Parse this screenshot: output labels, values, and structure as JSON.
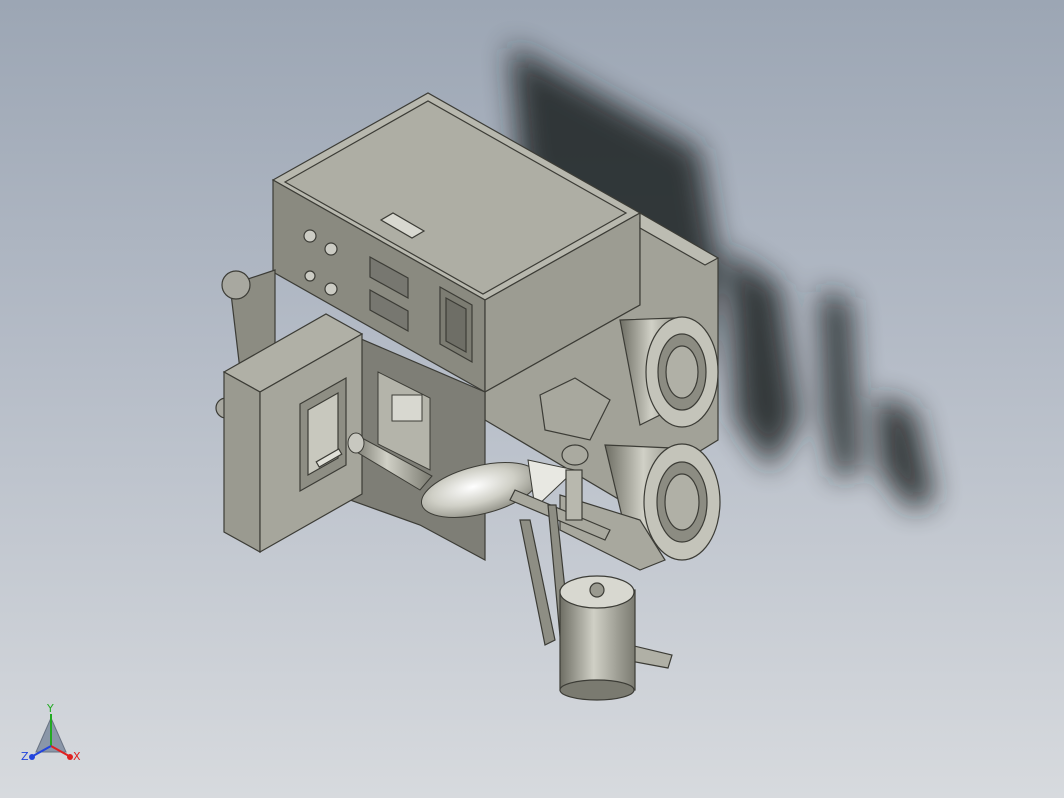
{
  "viewport": {
    "background_top": "#9ca6b4",
    "background_bottom": "#d7dade",
    "model_color": "#96968a",
    "shadow_color": "#1e2024"
  },
  "triad": {
    "x_label": "X",
    "y_label": "Y",
    "z_label": "Z",
    "x_color": "#e02020",
    "y_color": "#22aa22",
    "z_color": "#2244dd"
  }
}
